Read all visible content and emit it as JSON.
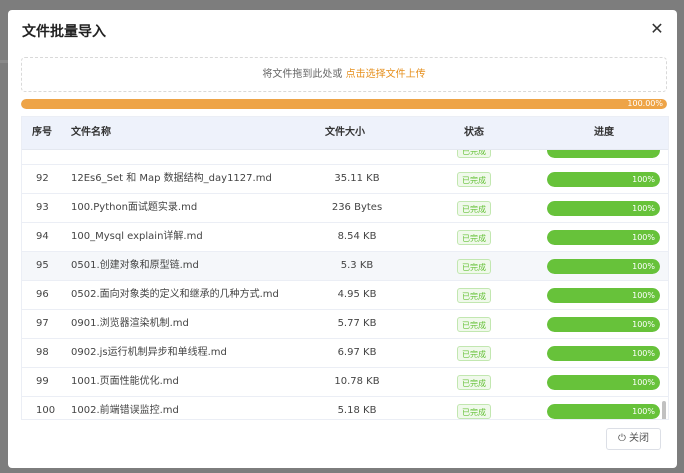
{
  "dialog": {
    "title": "文件批量导入",
    "close_icon": "close-icon",
    "dropzone": {
      "text": "将文件拖到此处或",
      "link": "点击选择文件上传"
    },
    "overall_progress": {
      "percent": 100,
      "label": "100.00%",
      "color": "#eea447"
    },
    "table": {
      "columns": [
        "序号",
        "文件名称",
        "文件大小",
        "状态",
        "进度"
      ],
      "rows": [
        {
          "index": "92",
          "name": "12Es6_Set 和 Map 数据结构_day1127.md",
          "size": "35.11 KB",
          "status": "已完成",
          "progress": 100,
          "progress_label": "100%"
        },
        {
          "index": "93",
          "name": "100.Python面试题实录.md",
          "size": "236 Bytes",
          "status": "已完成",
          "progress": 100,
          "progress_label": "100%"
        },
        {
          "index": "94",
          "name": "100_Mysql explain详解.md",
          "size": "8.54 KB",
          "status": "已完成",
          "progress": 100,
          "progress_label": "100%"
        },
        {
          "index": "95",
          "name": "0501.创建对象和原型链.md",
          "size": "5.3 KB",
          "status": "已完成",
          "progress": 100,
          "progress_label": "100%"
        },
        {
          "index": "96",
          "name": "0502.面向对象类的定义和继承的几种方式.md",
          "size": "4.95 KB",
          "status": "已完成",
          "progress": 100,
          "progress_label": "100%"
        },
        {
          "index": "97",
          "name": "0901.浏览器渲染机制.md",
          "size": "5.77 KB",
          "status": "已完成",
          "progress": 100,
          "progress_label": "100%"
        },
        {
          "index": "98",
          "name": "0902.js运行机制异步和单线程.md",
          "size": "6.97 KB",
          "status": "已完成",
          "progress": 100,
          "progress_label": "100%"
        },
        {
          "index": "99",
          "name": "1001.页面性能优化.md",
          "size": "10.78 KB",
          "status": "已完成",
          "progress": 100,
          "progress_label": "100%"
        },
        {
          "index": "100",
          "name": "1002.前端错误监控.md",
          "size": "5.18 KB",
          "status": "已完成",
          "progress": 100,
          "progress_label": "100%"
        }
      ],
      "partial_top_row": {
        "status": "已完成",
        "progress": 100
      },
      "highlighted_row": 3,
      "success_color": "#67c23a"
    },
    "footer": {
      "close_label": "关闭",
      "close_icon": "power-icon"
    }
  }
}
